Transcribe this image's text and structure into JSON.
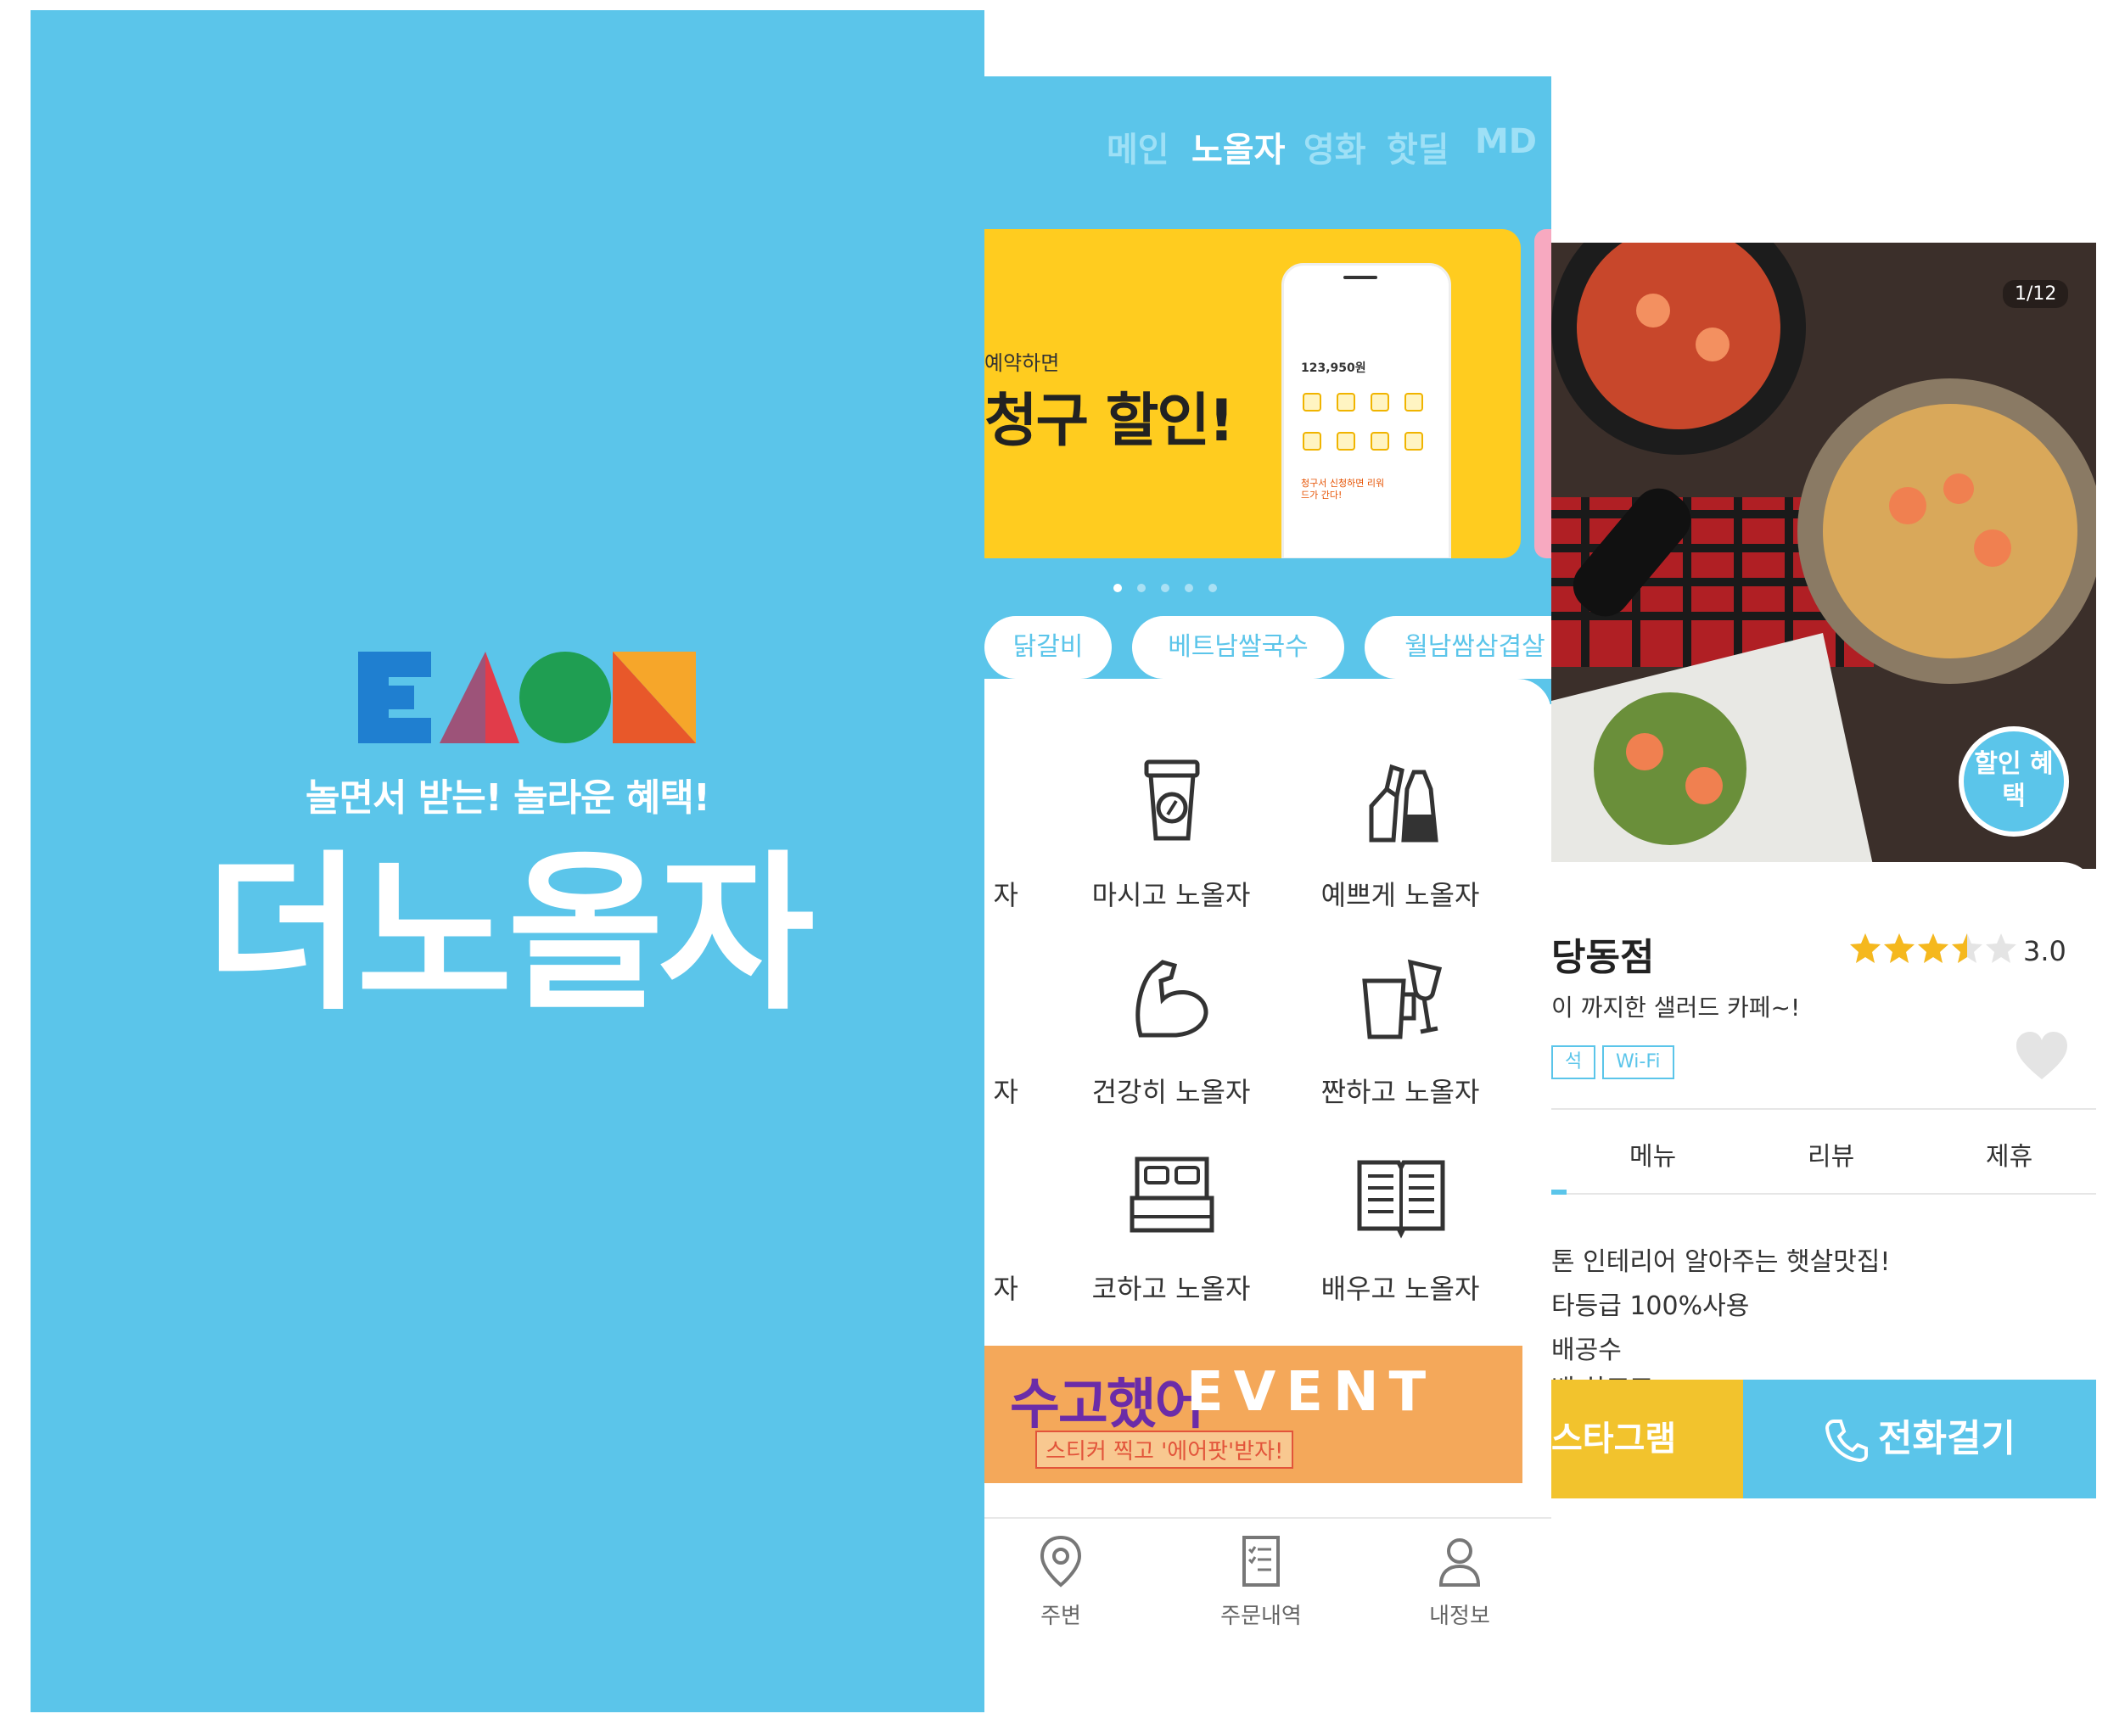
{
  "splash": {
    "tagline": "놀면서 받는! 놀라운 혜택!",
    "brand": "더노올자",
    "colors": {
      "background": "#5bc5ea",
      "blue": "#1f7fd0",
      "red": "#e13c4a",
      "green": "#1f9e52",
      "orange": "#f6a62a"
    }
  },
  "home": {
    "tabs": [
      "메인",
      "노올자",
      "영화",
      "핫딜",
      "MD"
    ],
    "active_tab": "노올자",
    "banner": {
      "subtitle": "예약하면",
      "title": "청구 할인!",
      "phone_amount": "123,950원",
      "phone_promo": "청구서 신청하면 리워드가 간다!"
    },
    "carousel_pages": 5,
    "carousel_active": 1,
    "chips": [
      "닭갈비",
      "베트남쌀국수",
      "월남쌈삼겹살"
    ],
    "categories": [
      {
        "label": "자",
        "icon": "cut-off-icon"
      },
      {
        "label": "마시고 노올자",
        "icon": "coffee-cup-icon"
      },
      {
        "label": "예쁘게 노올자",
        "icon": "cosmetics-icon"
      },
      {
        "label": "자",
        "icon": "cut-off-icon"
      },
      {
        "label": "건강히 노올자",
        "icon": "muscle-arm-icon"
      },
      {
        "label": "짠하고 노올자",
        "icon": "cheers-glasses-icon"
      },
      {
        "label": "자",
        "icon": "cut-off-icon"
      },
      {
        "label": "코하고 노올자",
        "icon": "bed-icon"
      },
      {
        "label": "배우고 노올자",
        "icon": "open-book-icon"
      }
    ],
    "event": {
      "title": "수고했어",
      "title_eng": "EVENT",
      "subtitle": "스티커 찍고 '에어팟'받자!"
    },
    "bottom_nav": [
      {
        "label": "주변",
        "icon": "location-pin-icon"
      },
      {
        "label": "주문내역",
        "icon": "order-list-icon"
      },
      {
        "label": "내정보",
        "icon": "user-icon"
      }
    ]
  },
  "detail": {
    "photo_counter": "1/12",
    "discount_bubble": "할인 혜택",
    "store_name": "당동점",
    "rating": 3.0,
    "rating_text": "3.0",
    "description": "이 까지한 샐러드 카페~!",
    "tags": [
      "석",
      "Wi-Fi"
    ],
    "tabs": [
      "메뉴",
      "리뷰",
      "제휴"
    ],
    "info_lines": [
      "톤 인테리어 알아주는 햇살맛집!",
      "타등급 100%사용",
      "배공수",
      "배 하조조"
    ],
    "buttons": {
      "instagram": "스타그램",
      "call": "전화걸기"
    }
  }
}
